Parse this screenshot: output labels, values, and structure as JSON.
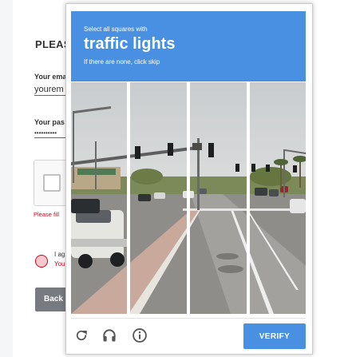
{
  "background_form": {
    "heading": "PLEAS",
    "email_label": "Your ema",
    "email_value": "yourem",
    "password_label": "Your pas",
    "password_value": "••••••••••",
    "error_text": "Please fill",
    "agree_text": "I ag",
    "agree_error": "You",
    "back_button": "Back"
  },
  "challenge": {
    "instruction_small": "Select all squares with",
    "target_object": "traffic lights",
    "skip_hint": "If there are none, click skip",
    "verify_label": "VERIFY",
    "grid": {
      "rows": 4,
      "cols": 4
    },
    "footer_icons": [
      "reload-icon",
      "audio-challenge-icon",
      "info-icon"
    ]
  },
  "colors": {
    "accent": "#4a90e2",
    "error": "#d0021b"
  }
}
